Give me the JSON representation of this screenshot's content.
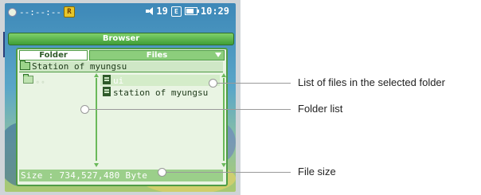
{
  "status_bar": {
    "time_display": "--:--:--",
    "mode_badge": "R",
    "track_number": "19",
    "eq_badge": "E",
    "clock": "10:29"
  },
  "window": {
    "title": "Browser"
  },
  "panel": {
    "folder_tab": "Folder",
    "files_tab": "Files",
    "current_path": "Station of myungsu",
    "folders": [
      ".."
    ],
    "files": [
      "ui",
      "station of myungsu"
    ],
    "selected_file_index": 0,
    "size_text": "Size : 734,527,480 Byte"
  },
  "callouts": {
    "files": "List of files in the selected folder",
    "folders": "Folder list",
    "size": "File size"
  },
  "colors": {
    "accent_green": "#4f9c45",
    "panel_bg": "#e9f4e3",
    "title_green": "#3f9e36"
  }
}
